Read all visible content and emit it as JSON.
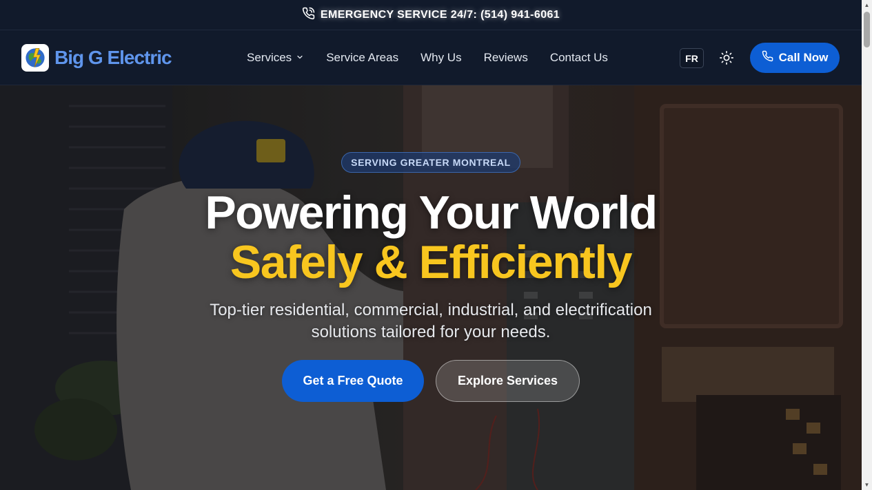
{
  "topbar": {
    "emergency_text": "EMERGENCY SERVICE 24/7:  (514) 941-6061",
    "icon": "phone-ringing-icon"
  },
  "brand": {
    "name": "Big G Electric",
    "logo_icon": "globe-logo-icon",
    "color": "#5f95ec"
  },
  "nav": {
    "items": [
      {
        "label": "Services",
        "has_dropdown": true
      },
      {
        "label": "Service Areas"
      },
      {
        "label": "Why Us"
      },
      {
        "label": "Reviews"
      },
      {
        "label": "Contact Us"
      }
    ],
    "lang_label": "FR",
    "theme_icon": "sun-icon",
    "call_label": "Call Now",
    "call_icon": "phone-icon"
  },
  "hero": {
    "badge": "SERVING GREATER MONTREAL",
    "headline_line1": "Powering Your World",
    "headline_line2": "Safely & Efficiently",
    "subtitle": "Top-tier residential, commercial, industrial, and electrification solutions tailored for your needs.",
    "primary_cta": "Get a Free Quote",
    "secondary_cta": "Explore Services"
  },
  "colors": {
    "accent_blue": "#0d5ed4",
    "accent_yellow": "#f8c61f",
    "nav_bg": "#111a2b"
  }
}
